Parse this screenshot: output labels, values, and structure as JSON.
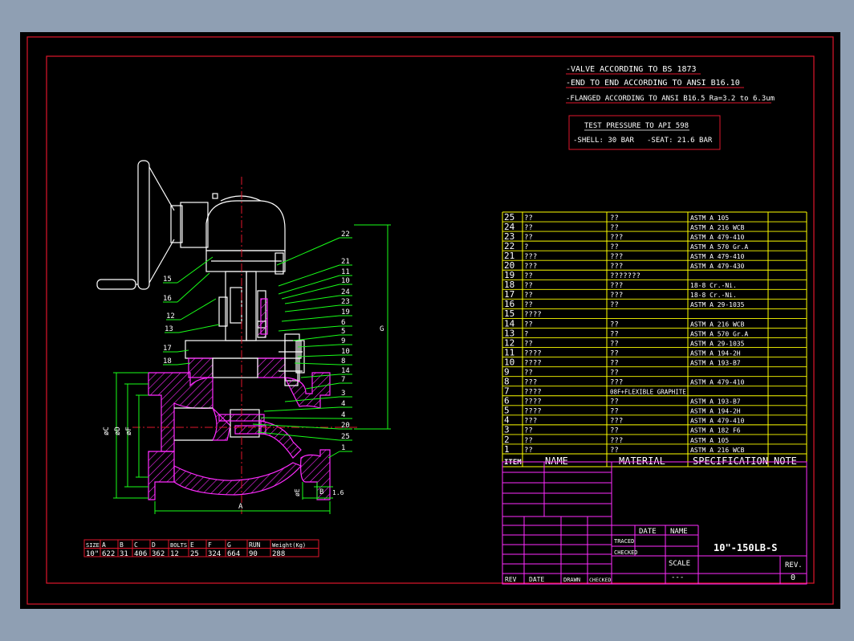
{
  "notes": [
    "-VALVE ACCORDING TO BS 1873",
    "-END TO END ACCORDING TO ANSI B16.10",
    "-FLANGED ACCORDING TO ANSI B16.5 Ra=3.2 to 6.3um"
  ],
  "test_pressure": {
    "title": "TEST PRESSURE TO API 598",
    "shell": "-SHELL: 30 BAR",
    "seat": "-SEAT: 21.6 BAR"
  },
  "callouts_right": [
    "22",
    "21",
    "11",
    "10",
    "24",
    "23",
    "19",
    "6",
    "5",
    "9",
    "10",
    "8",
    "14",
    "7",
    "3",
    "4",
    "4",
    "20",
    "25",
    "1"
  ],
  "callouts_left": [
    "15",
    "16",
    "12",
    "13",
    "17",
    "18"
  ],
  "dimension_labels": {
    "A": "A",
    "B": "B",
    "C": "øC",
    "D": "øD",
    "F": "øF",
    "E": "øE",
    "G": "G",
    "gap": "1.6"
  },
  "dims_table": {
    "headers": [
      "SIZE",
      "A",
      "B",
      "C",
      "D",
      "BOLTS",
      "E",
      "F",
      "G",
      "RUN",
      "Weight(Kg)"
    ],
    "values": [
      "10\"",
      "622",
      "31",
      "406",
      "362",
      "12",
      "25",
      "324",
      "664",
      "90",
      "288"
    ]
  },
  "parts": [
    {
      "item": "25",
      "name": "??",
      "material": "??",
      "spec": "ASTM A 105"
    },
    {
      "item": "24",
      "name": "??",
      "material": "??",
      "spec": "ASTM A 216 WCB"
    },
    {
      "item": "23",
      "name": "??",
      "material": "???",
      "spec": "ASTM A 479-410"
    },
    {
      "item": "22",
      "name": "?",
      "material": "??",
      "spec": "ASTM A 570 Gr.A"
    },
    {
      "item": "21",
      "name": "???",
      "material": "???",
      "spec": "ASTM A 479-410"
    },
    {
      "item": "20",
      "name": "???",
      "material": "???",
      "spec": "ASTM A 479-430"
    },
    {
      "item": "19",
      "name": "??",
      "material": "???????",
      "spec": ""
    },
    {
      "item": "18",
      "name": "??",
      "material": "???",
      "spec": "18-8 Cr.-Ni."
    },
    {
      "item": "17",
      "name": "??",
      "material": "???",
      "spec": "18-8 Cr.-Ni."
    },
    {
      "item": "16",
      "name": "??",
      "material": "??",
      "spec": "ASTM A 29-1035"
    },
    {
      "item": "15",
      "name": "????",
      "material": "",
      "spec": ""
    },
    {
      "item": "14",
      "name": "??",
      "material": "??",
      "spec": "ASTM A 216 WCB"
    },
    {
      "item": "13",
      "name": "?",
      "material": "??",
      "spec": "ASTM A 570 Gr.A"
    },
    {
      "item": "12",
      "name": "??",
      "material": "??",
      "spec": "ASTM A 29-1035"
    },
    {
      "item": "11",
      "name": "????",
      "material": "??",
      "spec": "ASTM A 194-2H"
    },
    {
      "item": "10",
      "name": "????",
      "material": "??",
      "spec": "ASTM A 193-B7"
    },
    {
      "item": "9",
      "name": "??",
      "material": "??",
      "spec": ""
    },
    {
      "item": "8",
      "name": "???",
      "material": "???",
      "spec": "ASTM A 479-410"
    },
    {
      "item": "7",
      "name": "????",
      "material": "08F+FLEXIBLE GRAPHITE",
      "spec": ""
    },
    {
      "item": "6",
      "name": "????",
      "material": "??",
      "spec": "ASTM A 193-B7"
    },
    {
      "item": "5",
      "name": "????",
      "material": "??",
      "spec": "ASTM A 194-2H"
    },
    {
      "item": "4",
      "name": "???",
      "material": "???",
      "spec": "ASTM A 479-410"
    },
    {
      "item": "3",
      "name": "??",
      "material": "??",
      "spec": "ASTM A 182 F6"
    },
    {
      "item": "2",
      "name": "??",
      "material": "???",
      "spec": "ASTM A 105"
    },
    {
      "item": "1",
      "name": "??",
      "material": "??",
      "spec": "ASTM A 216 WCB"
    }
  ],
  "parts_header": {
    "item": "ITEM",
    "name": "NAME",
    "material": "MATERIAL",
    "spec": "SPECIFICATION",
    "note": "NOTE"
  },
  "title_block": {
    "date": "DATE",
    "name": "NAME",
    "traced": "TRACED",
    "checked": "CHECKED",
    "drawing_title": "10\"-150LB-S",
    "scale_label": "SCALE",
    "scale_value": "---",
    "rev_label": "REV.",
    "rev_value": "0",
    "rev": "REV",
    "rev_date": "DATE",
    "drawn": "DRAWN",
    "rev_checked": "CHECKED"
  },
  "colors": {
    "background": "#000000",
    "border": "#e0162b",
    "table_lines": "#ffff00",
    "title_lines": "#ff2bff",
    "drawing": "#ffffff",
    "hatch": "#ff2bff",
    "leader": "#18ff18",
    "dims": "#18ff18",
    "text": "#ffffff"
  }
}
